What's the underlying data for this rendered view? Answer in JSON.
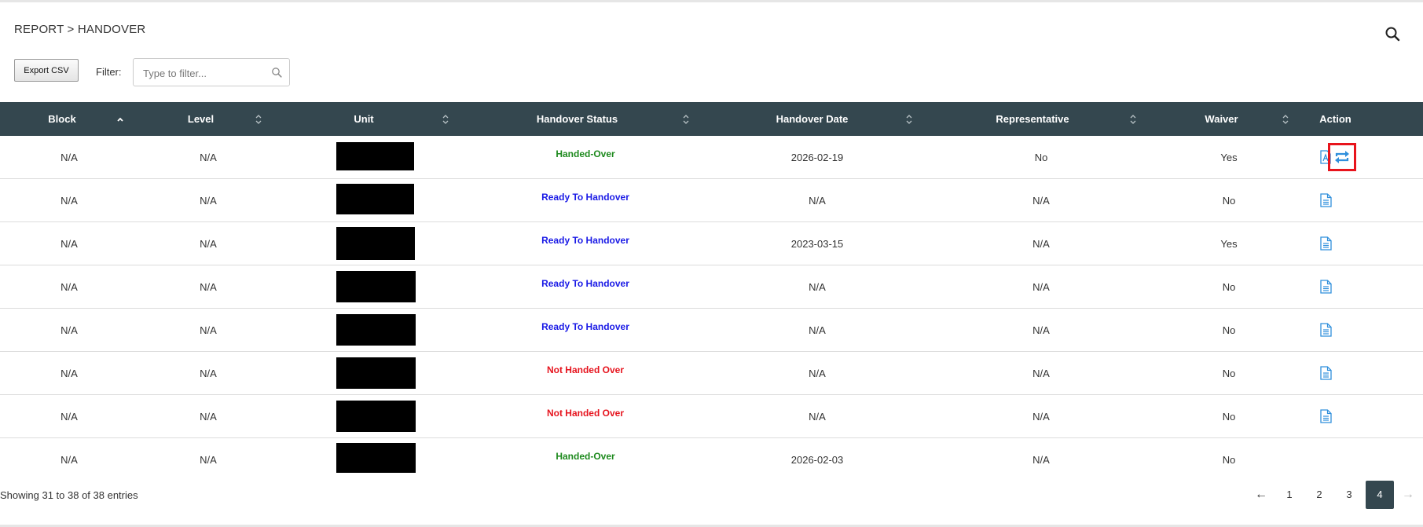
{
  "breadcrumb": "REPORT > HANDOVER",
  "toolbar": {
    "export_label": "Export CSV",
    "filter_label": "Filter:",
    "filter_placeholder": "Type to filter...",
    "filter_value": ""
  },
  "columns": [
    {
      "label": "Block",
      "sort": "asc"
    },
    {
      "label": "Level",
      "sort": "none"
    },
    {
      "label": "Unit",
      "sort": "none"
    },
    {
      "label": "Handover Status",
      "sort": "none"
    },
    {
      "label": "Handover Date",
      "sort": "none"
    },
    {
      "label": "Representative",
      "sort": "none"
    },
    {
      "label": "Waiver",
      "sort": "none"
    },
    {
      "label": "Action",
      "sort": null
    }
  ],
  "rows": [
    {
      "block": "N/A",
      "level": "N/A",
      "unit": "",
      "status": "Handed-Over",
      "status_color": "#1e8a1e",
      "date": "2026-02-19",
      "rep": "No",
      "waiver": "Yes",
      "actions": [
        "pdf-icon",
        "transfer-icon"
      ]
    },
    {
      "block": "N/A",
      "level": "N/A",
      "unit": "",
      "status": "Ready To Handover",
      "status_color": "#1a1ae6",
      "date": "N/A",
      "rep": "N/A",
      "waiver": "No",
      "actions": [
        "document-icon"
      ]
    },
    {
      "block": "N/A",
      "level": "N/A",
      "unit": "",
      "status": "Ready To Handover",
      "status_color": "#1a1ae6",
      "date": "2023-03-15",
      "rep": "N/A",
      "waiver": "Yes",
      "actions": [
        "document-icon"
      ]
    },
    {
      "block": "N/A",
      "level": "N/A",
      "unit": "",
      "status": "Ready To Handover",
      "status_color": "#1a1ae6",
      "date": "N/A",
      "rep": "N/A",
      "waiver": "No",
      "actions": [
        "document-icon"
      ]
    },
    {
      "block": "N/A",
      "level": "N/A",
      "unit": "",
      "status": "Ready To Handover",
      "status_color": "#1a1ae6",
      "date": "N/A",
      "rep": "N/A",
      "waiver": "No",
      "actions": [
        "document-icon"
      ]
    },
    {
      "block": "N/A",
      "level": "N/A",
      "unit": "",
      "status": "Not Handed Over",
      "status_color": "#e6141e",
      "date": "N/A",
      "rep": "N/A",
      "waiver": "No",
      "actions": [
        "document-icon"
      ]
    },
    {
      "block": "N/A",
      "level": "N/A",
      "unit": "",
      "status": "Not Handed Over",
      "status_color": "#e6141e",
      "date": "N/A",
      "rep": "N/A",
      "waiver": "No",
      "actions": [
        "document-icon"
      ]
    },
    {
      "block": "N/A",
      "level": "N/A",
      "unit": "",
      "status": "Handed-Over",
      "status_color": "#1e8a1e",
      "date": "2026-02-03",
      "rep": "N/A",
      "waiver": "No",
      "actions": []
    }
  ],
  "footer": {
    "info": "Showing 31 to 38 of 38 entries",
    "pages": [
      "1",
      "2",
      "3",
      "4"
    ],
    "current_page": "4",
    "prev_label": "←",
    "next_label": "→"
  },
  "colors": {
    "header_bg": "#34474f",
    "icon_blue": "#2f8fdc",
    "highlight": "#e8141c"
  }
}
